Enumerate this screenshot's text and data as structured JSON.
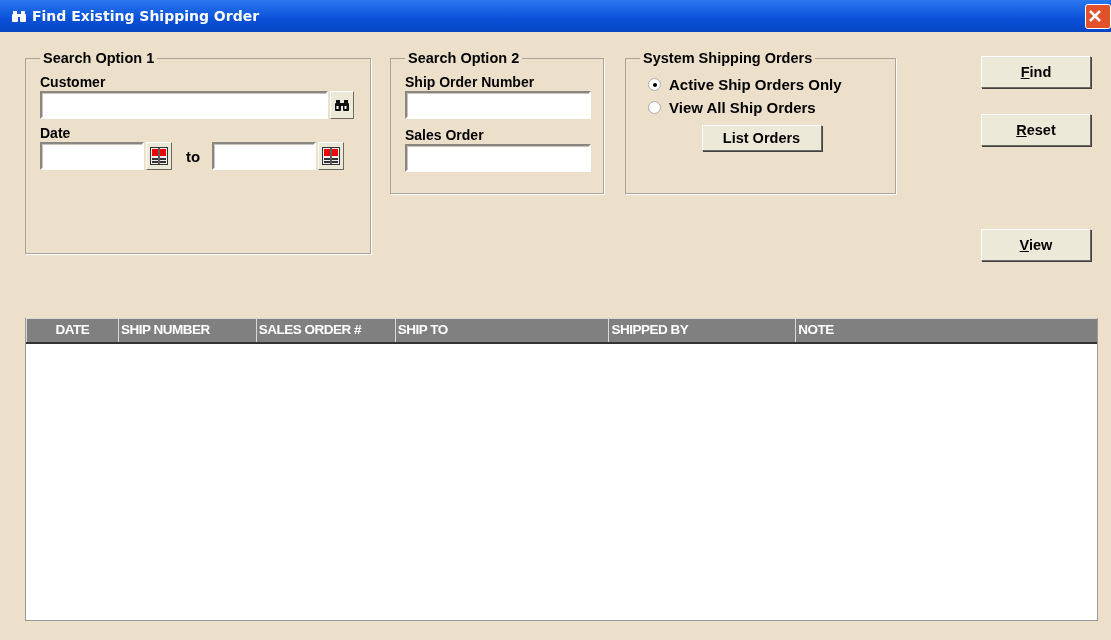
{
  "window": {
    "title": "Find Existing Shipping Order"
  },
  "search_option_1": {
    "title": "Search Option 1",
    "customer": {
      "label": "Customer"
    },
    "date": {
      "label": "Date",
      "separator": "to"
    }
  },
  "search_option_2": {
    "title": "Search Option 2",
    "fields": [
      {
        "label": "Ship Order Number"
      },
      {
        "label": "Sales Order"
      }
    ]
  },
  "system_shipping_orders": {
    "title": "System Shipping Orders",
    "options": [
      {
        "label": "Active Ship Orders Only",
        "selected": true
      },
      {
        "label": "View All Ship Orders",
        "selected": false
      }
    ],
    "button": "List Orders"
  },
  "buttons": [
    {
      "label": "Find",
      "mnemonic": true
    },
    {
      "label": "Reset",
      "mnemonic": true
    },
    {
      "label": "View",
      "mnemonic": true
    }
  ],
  "table": {
    "columns": [
      {
        "label": "DATE"
      },
      {
        "label": "SHIP NUMBER"
      },
      {
        "label": "SALES ORDER #"
      },
      {
        "label": "SHIP TO"
      },
      {
        "label": "SHIPPED BY"
      },
      {
        "label": "NOTE"
      }
    ]
  }
}
